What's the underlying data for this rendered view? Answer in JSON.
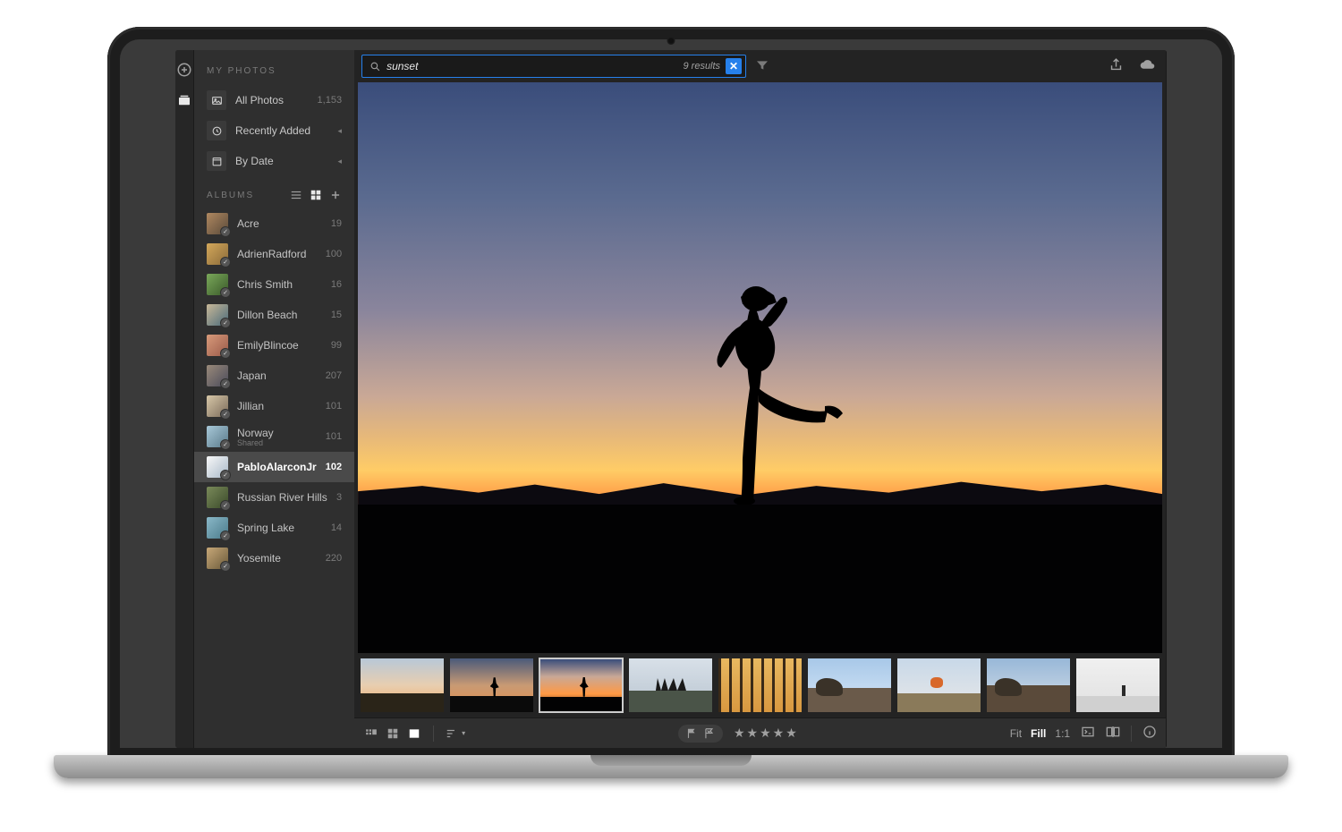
{
  "search": {
    "value": "sunset",
    "results_label": "9 results"
  },
  "sidebar": {
    "my_photos_title": "MY PHOTOS",
    "nav": [
      {
        "label": "All Photos",
        "count": "1,153"
      },
      {
        "label": "Recently Added",
        "count": ""
      },
      {
        "label": "By Date",
        "count": ""
      }
    ],
    "albums_title": "ALBUMS",
    "albums": [
      {
        "name": "Acre",
        "count": "19",
        "c1": "#b08860",
        "c2": "#5a4a3a"
      },
      {
        "name": "AdrienRadford",
        "count": "100",
        "c1": "#d4a85a",
        "c2": "#8a6a3a"
      },
      {
        "name": "Chris Smith",
        "count": "16",
        "c1": "#7aa85a",
        "c2": "#3a5a2a"
      },
      {
        "name": "Dillon Beach",
        "count": "15",
        "c1": "#c8b898",
        "c2": "#4a6a7a"
      },
      {
        "name": "EmilyBlincoe",
        "count": "99",
        "c1": "#d89a7a",
        "c2": "#9a5a4a"
      },
      {
        "name": "Japan",
        "count": "207",
        "c1": "#9a8a7a",
        "c2": "#4a4a5a"
      },
      {
        "name": "Jillian",
        "count": "101",
        "c1": "#d8c8a8",
        "c2": "#7a6a5a"
      },
      {
        "name": "Norway",
        "sub": "Shared",
        "count": "101",
        "c1": "#a8c8d8",
        "c2": "#5a7a8a"
      },
      {
        "name": "PabloAlarconJr",
        "count": "102",
        "selected": true,
        "c1": "#f8f8f8",
        "c2": "#a8b8c8"
      },
      {
        "name": "Russian River Hills",
        "count": "3",
        "c1": "#7a8a5a",
        "c2": "#3a4a2a"
      },
      {
        "name": "Spring Lake",
        "count": "14",
        "c1": "#8ab8c8",
        "c2": "#4a7a8a"
      },
      {
        "name": "Yosemite",
        "count": "220",
        "c1": "#c8a878",
        "c2": "#6a5a3a"
      }
    ]
  },
  "bottombar": {
    "zoom_fit": "Fit",
    "zoom_fill": "Fill",
    "zoom_11": "1:1"
  },
  "filmstrip_selected_index": 2
}
